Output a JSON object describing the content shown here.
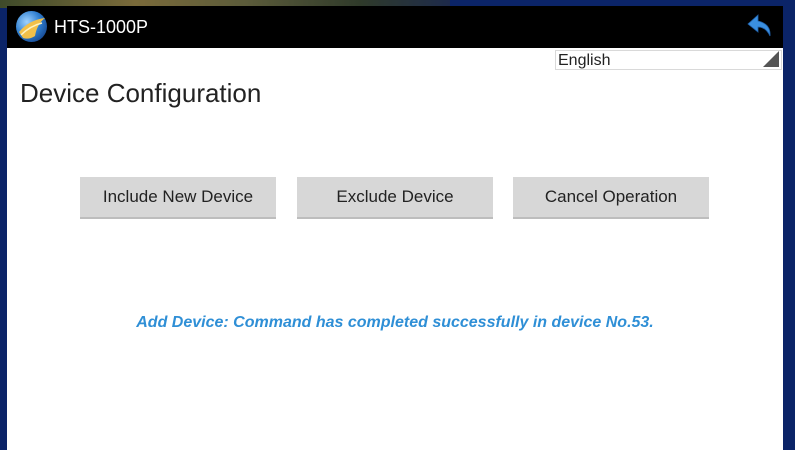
{
  "app": {
    "title": "HTS-1000P"
  },
  "icons": {
    "logo": "app-logo-icon",
    "back": "back-arrow-icon",
    "dropdown": "dropdown-triangle-icon"
  },
  "language_select": {
    "value": "English"
  },
  "page": {
    "title": "Device Configuration"
  },
  "buttons": {
    "include_label": "Include New Device",
    "exclude_label": "Exclude Device",
    "cancel_label": "Cancel Operation"
  },
  "status": {
    "message": "Add Device: Command has completed successfully in device No.53."
  },
  "colors": {
    "titlebar": "#000000",
    "status_text": "#2f8fd6",
    "button_bg": "#d7d7d7",
    "outer_bg": "#0b2468",
    "back_icon": "#3a8fe0"
  }
}
